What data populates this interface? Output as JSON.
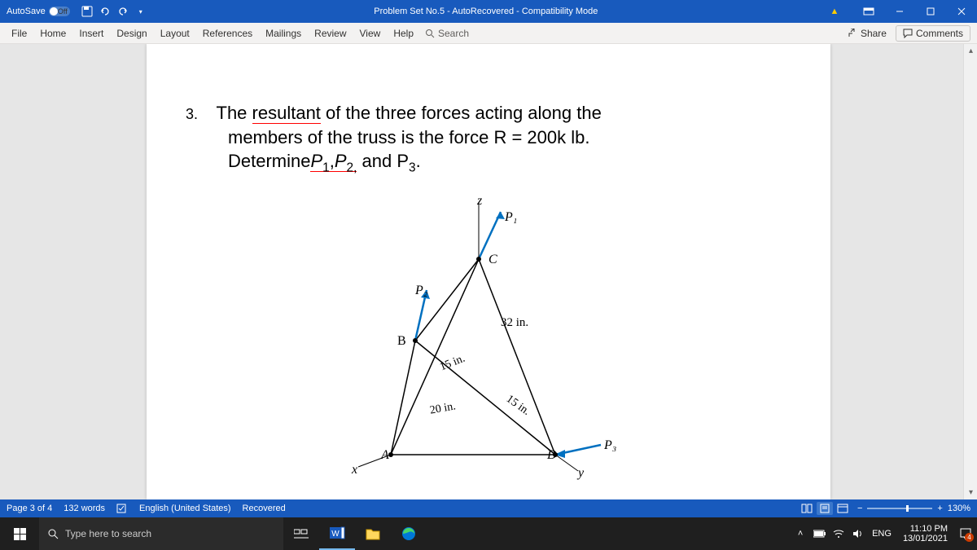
{
  "title_bar": {
    "autosave_label": "AutoSave",
    "autosave_state": "Off",
    "doc_title": "Problem Set No.5 - AutoRecovered - Compatibility Mode"
  },
  "ribbon": {
    "tabs": [
      "File",
      "Home",
      "Insert",
      "Design",
      "Layout",
      "References",
      "Mailings",
      "Review",
      "View",
      "Help"
    ],
    "search_placeholder": "Search",
    "share_label": "Share",
    "comments_label": "Comments"
  },
  "document": {
    "problem_number": "3.",
    "line1_a": "The ",
    "line1_b": "resultant",
    "line1_c": " of the three forces acting along the",
    "line2": "members of the truss is the force R = 200k lb.",
    "line3_a": "Determine",
    "line3_b": "P",
    "line3_c": "1",
    "line3_d": ",",
    "line3_e": "P",
    "line3_f": "2,",
    "line3_g": " and P",
    "line3_h": "3",
    "line3_i": ".",
    "diagram": {
      "z": "z",
      "P1": "P₁",
      "C": "C",
      "P2": "P₂",
      "B": "B",
      "len32": "32 in.",
      "len15a": "15 in.",
      "len15b": "15 in.",
      "len20": "20 in.",
      "A": "A",
      "D": "D",
      "P3": "P₃",
      "x": "x",
      "y": "y"
    }
  },
  "status": {
    "page": "Page 3 of 4",
    "words": "132 words",
    "lang": "English (United States)",
    "saved": "Recovered",
    "zoom": "130%"
  },
  "taskbar": {
    "search_placeholder": "Type here to search",
    "lang": "ENG",
    "time": "11:10 PM",
    "date": "13/01/2021",
    "notif_count": "4"
  }
}
